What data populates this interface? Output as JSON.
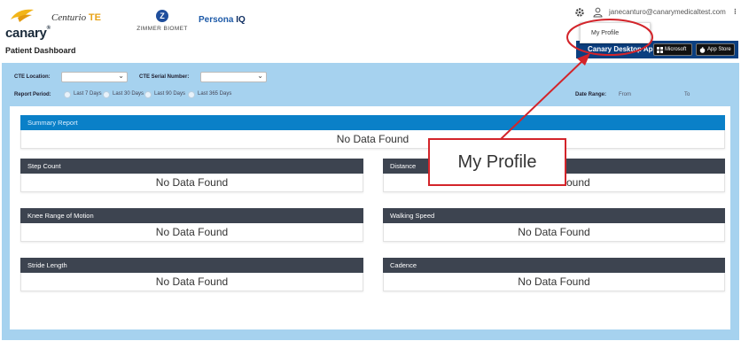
{
  "header": {
    "brand": "canary",
    "brand_tm": "®",
    "centurio": "Centurio",
    "centurio_te": "TE",
    "zimmer_mark": "Z",
    "zimmer": "ZIMMER BIOMET",
    "persona": "Persona",
    "persona_iq": "IQ",
    "page_title": "Patient Dashboard",
    "user_email": "janecanturo@canarymedicaltest.com",
    "kebab": "⁝",
    "download_label": "Canary Desktop Application",
    "store_microsoft": "Microsoft",
    "store_apple": "App Store"
  },
  "user_menu": {
    "items": [
      "My Profile"
    ]
  },
  "filters": {
    "cte_location_label": "CTE Location:",
    "cte_serial_label": "CTE Serial Number:",
    "report_period_label": "Report Period:",
    "periods": [
      "Last 7 Days",
      "Last 30 Days",
      "Last 90 Days",
      "Last 365 Days"
    ],
    "date_range_label": "Date Range:",
    "date_from": "From",
    "date_to": "To"
  },
  "summary": {
    "title": "Summary Report",
    "empty": "No Data Found"
  },
  "cards": [
    {
      "title": "Step Count",
      "empty": "No Data Found"
    },
    {
      "title": "Distance",
      "empty": "No Data Found"
    },
    {
      "title": "Knee Range of Motion",
      "empty": "No Data Found"
    },
    {
      "title": "Walking Speed",
      "empty": "No Data Found"
    },
    {
      "title": "Stride Length",
      "empty": "No Data Found"
    },
    {
      "title": "Cadence",
      "empty": "No Data Found"
    }
  ],
  "annotation": {
    "callout_text": "My Profile",
    "color": "#d3242a"
  },
  "colors": {
    "filter_bg": "#a6d2ef",
    "card_header": "#3d4450",
    "summary_header": "#0a80c8",
    "download_bar": "#0b3f80"
  }
}
